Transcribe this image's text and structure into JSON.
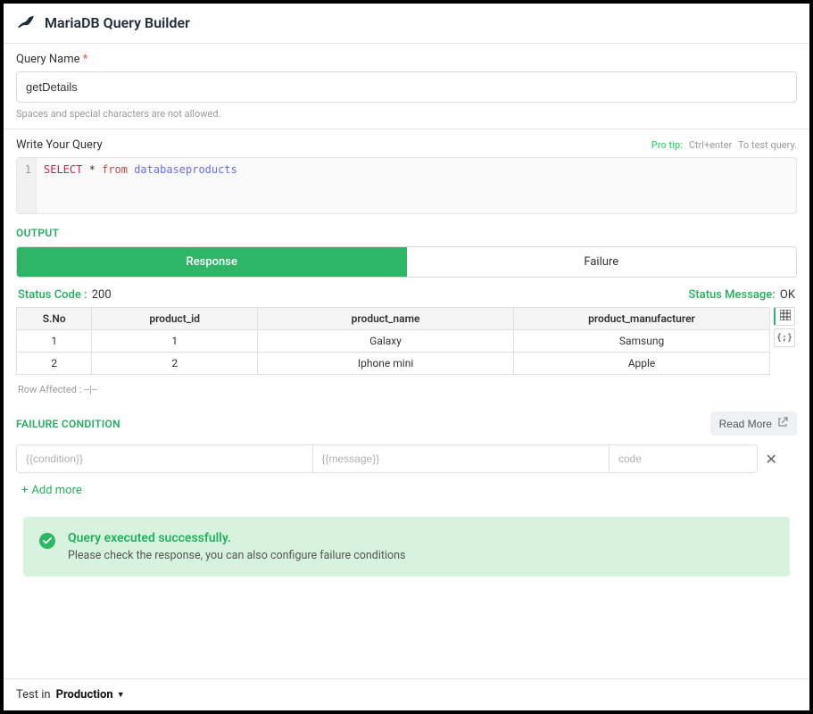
{
  "header": {
    "title": "MariaDB Query Builder"
  },
  "queryName": {
    "label": "Query Name",
    "required": "*",
    "value": "getDetails",
    "helper": "Spaces and special characters are not allowed."
  },
  "queryEditor": {
    "label": "Write Your Query",
    "proTipLabel": "Pro tip:",
    "proTipKey": "Ctrl+enter",
    "proTipSuffix": "To test query.",
    "lineNo": "1",
    "tokSelect": "SELECT",
    "tokStar": "*",
    "tokFrom": "from",
    "tokIdent": "databaseproducts"
  },
  "output": {
    "sectionLabel": "OUTPUT",
    "tabs": {
      "response": "Response",
      "failure": "Failure"
    },
    "statusCodeLabel": "Status Code :",
    "statusCodeValue": "200",
    "statusMsgLabel": "Status Message:",
    "statusMsgValue": "OK",
    "columns": {
      "c0": "S.No",
      "c1": "product_id",
      "c2": "product_name",
      "c3": "product_manufacturer"
    },
    "rows": [
      {
        "sno": "1",
        "pid": "1",
        "pname": "Galaxy",
        "pmfr": "Samsung"
      },
      {
        "sno": "2",
        "pid": "2",
        "pname": "Iphone mini",
        "pmfr": "Apple"
      }
    ],
    "rowAffected": "Row Affected : --|--",
    "jsonToggle": "{;}"
  },
  "failureCond": {
    "sectionLabel": "FAILURE CONDITION",
    "readMore": "Read More",
    "ph_condition": "{{condition}}",
    "ph_message": "{{message}}",
    "ph_code": "code",
    "addMore": "Add more"
  },
  "banner": {
    "title": "Query executed successfully.",
    "subtitle": "Please check the response, you can also configure failure conditions"
  },
  "footer": {
    "label": "Test in",
    "env": "Production"
  }
}
